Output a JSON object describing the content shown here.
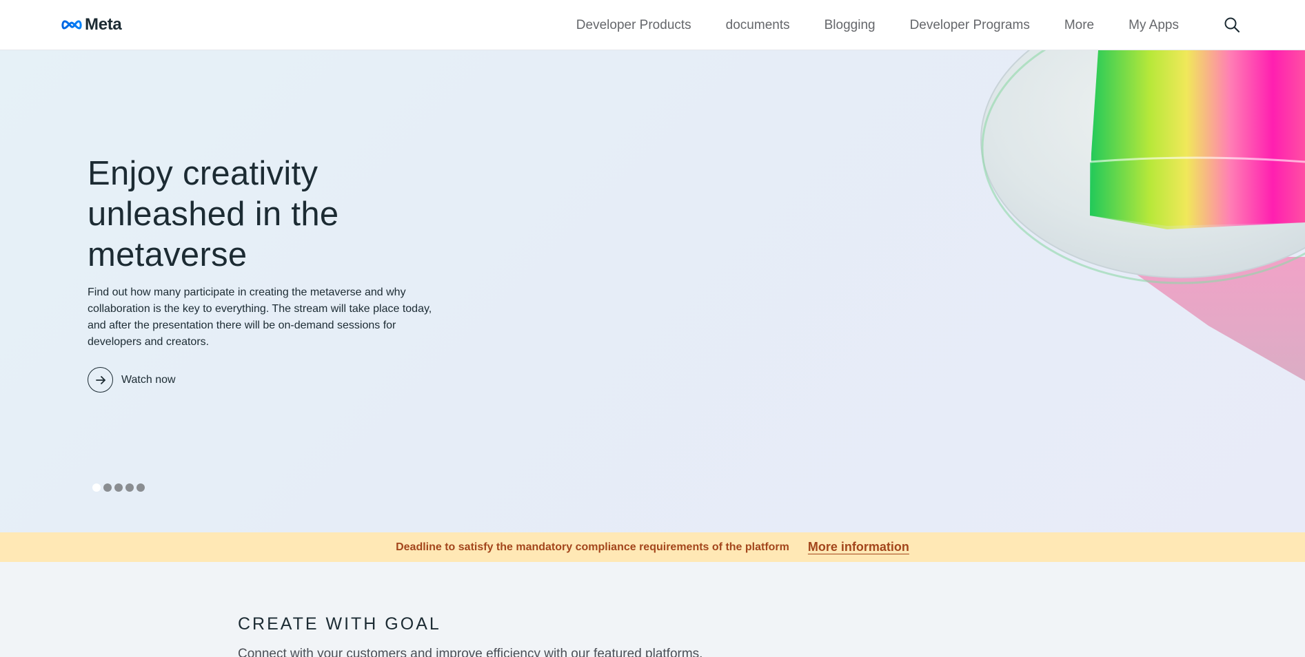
{
  "nav": {
    "brand": "Meta",
    "links": [
      "Developer Products",
      "documents",
      "Blogging",
      "Developer Programs",
      "More",
      "My Apps"
    ],
    "search_icon": "search-icon"
  },
  "hero": {
    "title": "Enjoy creativity unleashed in the metaverse",
    "description": "Find out how many participate in creating the metaverse and why collaboration is the key to everything. The stream will take place today, and after the presentation there will be on-demand sessions for developers and creators.",
    "cta_label": "Watch now",
    "cta_icon": "arrow-right-icon",
    "carousel_slides": 5,
    "carousel_active_index": 0
  },
  "banner": {
    "text": "Deadline to satisfy the mandatory compliance requirements of the platform",
    "link_label": "More information",
    "colors": {
      "background": "#ffe8b5",
      "text": "#a3461c"
    }
  },
  "section": {
    "title": "CREATE WITH GOAL",
    "subtitle": "Connect with your customers and improve efficiency with our featured platforms."
  },
  "colors": {
    "brand_blue": "#0668e1",
    "text_dark": "#1c2b33",
    "nav_text": "#65676b"
  }
}
